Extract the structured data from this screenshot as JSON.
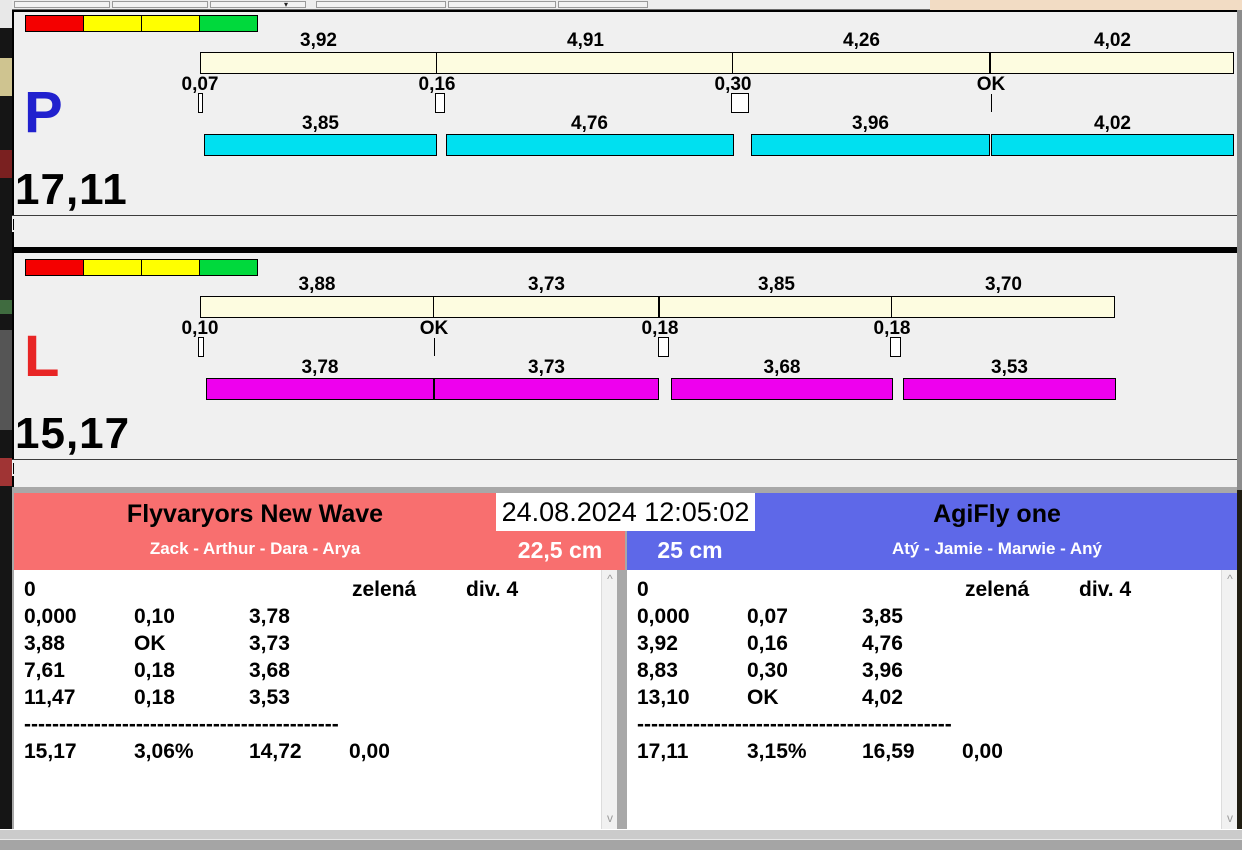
{
  "datetime": "24.08.2024 12:05:02",
  "colors": {
    "cream_bar": "#FDFCE0",
    "p_bar": "#00E0F0",
    "l_bar": "#EE00EE",
    "p_letter": "#2121CE",
    "l_letter": "#E82525",
    "team_left_header": "#F86F6F",
    "team_right_header": "#5E68E8",
    "lights": [
      "#F40000",
      "#FFFF00",
      "#FFFF00",
      "#00D93C"
    ]
  },
  "lanes": [
    {
      "letter": "P",
      "letter_color": "#2121CE",
      "total": "17,11",
      "bar_color": "#00E0F0",
      "lights": [
        "#F40000",
        "#FFFF00",
        "#FFFF00",
        "#00D93C"
      ],
      "top_segments": [
        {
          "label": "3,92",
          "t": 3.92
        },
        {
          "label": "4,91",
          "t": 4.91
        },
        {
          "label": "4,26",
          "t": 4.26
        },
        {
          "label": "4,02",
          "t": 4.02
        }
      ],
      "markers": [
        {
          "label": "0,07",
          "t": 0.07
        },
        {
          "label": "0,16",
          "t": 0.16
        },
        {
          "label": "0,30",
          "t": 0.3
        },
        {
          "label": "OK",
          "t": 0
        }
      ],
      "bottom_segments": [
        {
          "label": "3,85",
          "t": 3.85
        },
        {
          "label": "4,76",
          "t": 4.76
        },
        {
          "label": "3,96",
          "t": 3.96
        },
        {
          "label": "4,02",
          "t": 4.02
        }
      ]
    },
    {
      "letter": "L",
      "letter_color": "#E82525",
      "total": "15,17",
      "bar_color": "#EE00EE",
      "lights": [
        "#F40000",
        "#FFFF00",
        "#FFFF00",
        "#00D93C"
      ],
      "top_segments": [
        {
          "label": "3,88",
          "t": 3.88
        },
        {
          "label": "3,73",
          "t": 3.73
        },
        {
          "label": "3,85",
          "t": 3.85
        },
        {
          "label": "3,70",
          "t": 3.7
        }
      ],
      "markers": [
        {
          "label": "0,10",
          "t": 0.1
        },
        {
          "label": "OK",
          "t": 0
        },
        {
          "label": "0,18",
          "t": 0.18
        },
        {
          "label": "0,18",
          "t": 0.18
        }
      ],
      "bottom_segments": [
        {
          "label": "3,78",
          "t": 3.78
        },
        {
          "label": "3,73",
          "t": 3.73
        },
        {
          "label": "3,68",
          "t": 3.68
        },
        {
          "label": "3,53",
          "t": 3.53
        }
      ]
    }
  ],
  "teams": [
    {
      "name": "Flyvaryors New Wave",
      "members": "Zack - Arthur - Dara - Arya",
      "height": "22,5 cm",
      "header_color": "#F86F6F",
      "first_row": {
        "start": "0",
        "color_word": "zelená",
        "division": "div. 4"
      },
      "rows": [
        [
          "0,000",
          "0,10",
          "3,78"
        ],
        [
          "3,88",
          "OK",
          "3,73"
        ],
        [
          "7,61",
          "0,18",
          "3,68"
        ],
        [
          "11,47",
          "0,18",
          "3,53"
        ]
      ],
      "separator": "---------------------------------------------",
      "totals": [
        "15,17",
        "3,06%",
        "14,72",
        "0,00"
      ]
    },
    {
      "name": "AgiFly one",
      "members": "Atý - Jamie - Marwie - Aný",
      "height": "25 cm",
      "header_color": "#5E68E8",
      "first_row": {
        "start": "0",
        "color_word": "zelená",
        "division": "div. 4"
      },
      "rows": [
        [
          "0,000",
          "0,07",
          "3,85"
        ],
        [
          "3,92",
          "0,16",
          "4,76"
        ],
        [
          "8,83",
          "0,30",
          "3,96"
        ],
        [
          "13,10",
          "OK",
          "4,02"
        ]
      ],
      "separator": "---------------------------------------------",
      "totals": [
        "17,11",
        "3,15%",
        "16,59",
        "0,00"
      ]
    }
  ],
  "scrollbar": {
    "up": "^",
    "down": "v"
  }
}
